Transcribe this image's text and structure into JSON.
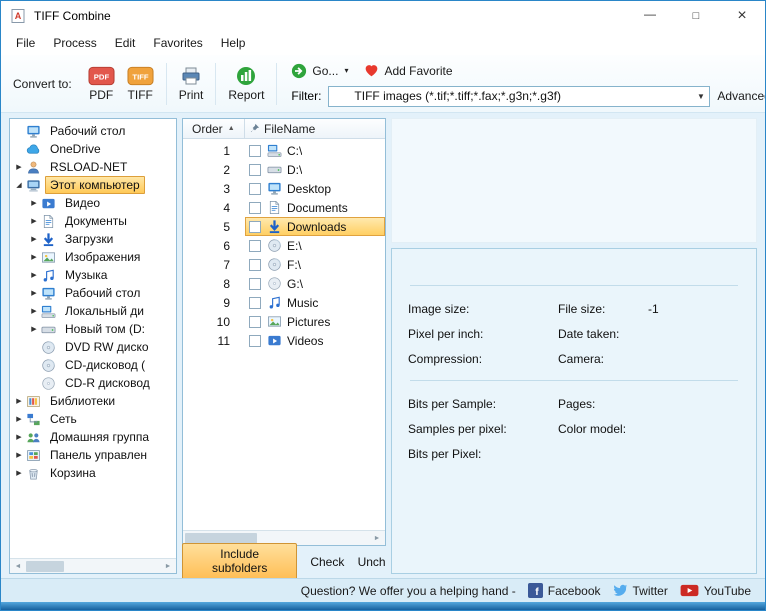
{
  "window": {
    "title": "TIFF Combine"
  },
  "menu": {
    "items": [
      "File",
      "Process",
      "Edit",
      "Favorites",
      "Help"
    ]
  },
  "toolbar": {
    "convert_label": "Convert to:",
    "pdf_label": "PDF",
    "tiff_label": "TIFF",
    "print_label": "Print",
    "report_label": "Report",
    "go_label": "Go...",
    "add_favorite_label": "Add Favorite",
    "filter_label": "Filter:",
    "filter_value": "TIFF images (*.tif;*.tiff;*.fax;*.g3n;*.g3f)",
    "advanced_filter_label": "Advanced filter"
  },
  "tree": {
    "items": [
      {
        "label": "Рабочий стол",
        "icon": "desktop",
        "level": 0,
        "arrow": ""
      },
      {
        "label": "OneDrive",
        "icon": "cloud",
        "level": 0,
        "arrow": ""
      },
      {
        "label": "RSLOAD-NET",
        "icon": "user",
        "level": 0,
        "arrow": "collapsed"
      },
      {
        "label": "Этот компьютер",
        "icon": "computer",
        "level": 0,
        "arrow": "expanded",
        "selected": true
      },
      {
        "label": "Видео",
        "icon": "video",
        "level": 1,
        "arrow": "collapsed"
      },
      {
        "label": "Документы",
        "icon": "document",
        "level": 1,
        "arrow": "collapsed"
      },
      {
        "label": "Загрузки",
        "icon": "download",
        "level": 1,
        "arrow": "collapsed"
      },
      {
        "label": "Изображения",
        "icon": "picture",
        "level": 1,
        "arrow": "collapsed"
      },
      {
        "label": "Музыка",
        "icon": "music",
        "level": 1,
        "arrow": "collapsed"
      },
      {
        "label": "Рабочий стол",
        "icon": "desktop",
        "level": 1,
        "arrow": "collapsed"
      },
      {
        "label": "Локальный ди",
        "icon": "drive-sys",
        "level": 1,
        "arrow": "collapsed"
      },
      {
        "label": "Новый том (D:",
        "icon": "drive",
        "level": 1,
        "arrow": "collapsed"
      },
      {
        "label": "DVD RW диско",
        "icon": "cd-drive",
        "level": 1,
        "arrow": ""
      },
      {
        "label": "CD-дисковод (",
        "icon": "cd-drive",
        "level": 1,
        "arrow": ""
      },
      {
        "label": "CD-R дисковод",
        "icon": "cd",
        "level": 1,
        "arrow": ""
      },
      {
        "label": "Библиотеки",
        "icon": "library",
        "level": 0,
        "arrow": "collapsed"
      },
      {
        "label": "Сеть",
        "icon": "network",
        "level": 0,
        "arrow": "collapsed"
      },
      {
        "label": "Домашняя группа",
        "icon": "homegroup",
        "level": 0,
        "arrow": "collapsed"
      },
      {
        "label": "Панель управлен",
        "icon": "control-panel",
        "level": 0,
        "arrow": "collapsed"
      },
      {
        "label": "Корзина",
        "icon": "recycle-bin",
        "level": 0,
        "arrow": "collapsed"
      }
    ]
  },
  "filelist": {
    "columns": {
      "order": "Order",
      "filename": "FileName"
    },
    "sort_indicator": "▲",
    "rows": [
      {
        "order": "1",
        "name": "C:\\",
        "icon": "drive-sys"
      },
      {
        "order": "2",
        "name": "D:\\",
        "icon": "drive"
      },
      {
        "order": "3",
        "name": "Desktop",
        "icon": "desktop"
      },
      {
        "order": "4",
        "name": "Documents",
        "icon": "document"
      },
      {
        "order": "5",
        "name": "Downloads",
        "icon": "download",
        "selected": true
      },
      {
        "order": "6",
        "name": "E:\\",
        "icon": "cd-drive"
      },
      {
        "order": "7",
        "name": "F:\\",
        "icon": "cd-drive"
      },
      {
        "order": "8",
        "name": "G:\\",
        "icon": "cd"
      },
      {
        "order": "9",
        "name": "Music",
        "icon": "music"
      },
      {
        "order": "10",
        "name": "Pictures",
        "icon": "picture"
      },
      {
        "order": "11",
        "name": "Videos",
        "icon": "video"
      }
    ]
  },
  "actions": {
    "include_subfolders": "Include subfolders",
    "check": "Check",
    "uncheck": "Unch"
  },
  "preview": {
    "rows": [
      {
        "left": "Image size:",
        "right": "File size:",
        "right_value": "-1"
      },
      {
        "left": "Pixel per inch:",
        "right": "Date taken:",
        "right_value": ""
      },
      {
        "left": "Compression:",
        "right": "Camera:",
        "right_value": ""
      },
      {
        "left": "Bits per Sample:",
        "right": "Pages:",
        "right_value": "",
        "new_group": true
      },
      {
        "left": "Samples per pixel:",
        "right": "Color model:",
        "right_value": ""
      },
      {
        "left": "Bits per Pixel:",
        "right": "",
        "right_value": ""
      }
    ]
  },
  "statusbar": {
    "message": "Question? We offer you a helping hand -",
    "links": [
      {
        "label": "Facebook",
        "icon": "facebook"
      },
      {
        "label": "Twitter",
        "icon": "twitter"
      },
      {
        "label": "YouTube",
        "icon": "youtube"
      }
    ]
  }
}
